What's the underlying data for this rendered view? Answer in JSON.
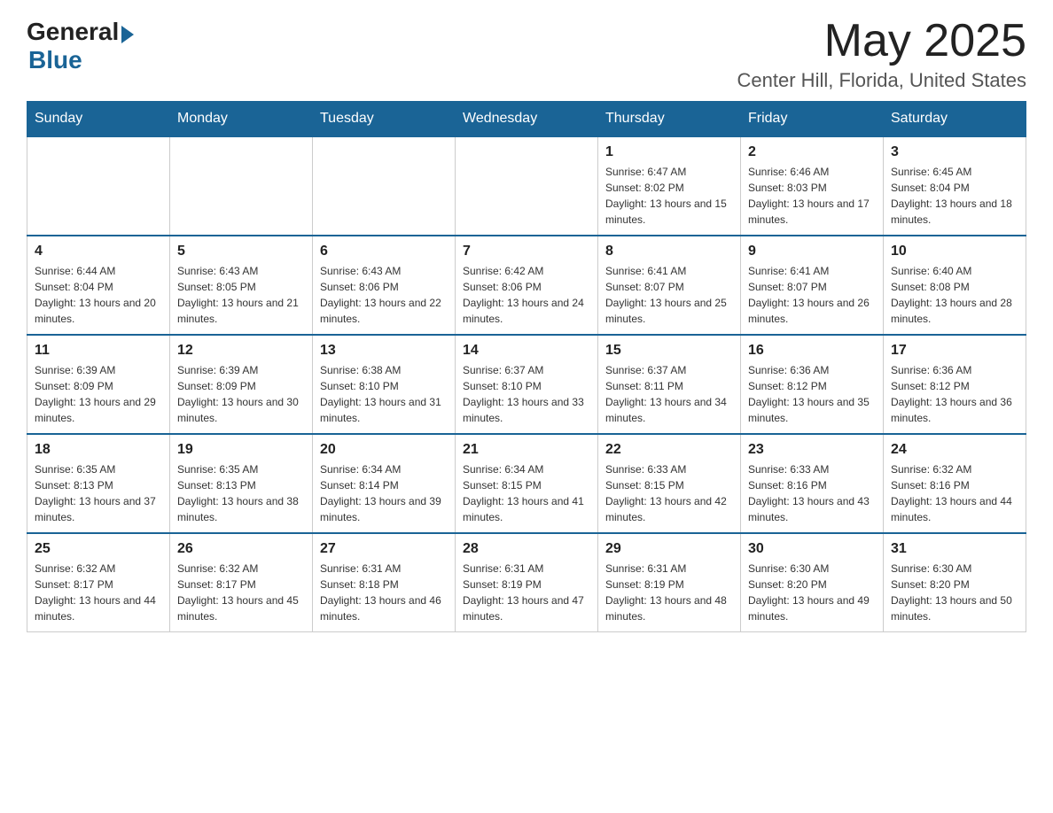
{
  "header": {
    "logo_general": "General",
    "logo_blue": "Blue",
    "month": "May 2025",
    "location": "Center Hill, Florida, United States"
  },
  "days_of_week": [
    "Sunday",
    "Monday",
    "Tuesday",
    "Wednesday",
    "Thursday",
    "Friday",
    "Saturday"
  ],
  "weeks": [
    [
      {
        "day": "",
        "info": ""
      },
      {
        "day": "",
        "info": ""
      },
      {
        "day": "",
        "info": ""
      },
      {
        "day": "",
        "info": ""
      },
      {
        "day": "1",
        "info": "Sunrise: 6:47 AM\nSunset: 8:02 PM\nDaylight: 13 hours and 15 minutes."
      },
      {
        "day": "2",
        "info": "Sunrise: 6:46 AM\nSunset: 8:03 PM\nDaylight: 13 hours and 17 minutes."
      },
      {
        "day": "3",
        "info": "Sunrise: 6:45 AM\nSunset: 8:04 PM\nDaylight: 13 hours and 18 minutes."
      }
    ],
    [
      {
        "day": "4",
        "info": "Sunrise: 6:44 AM\nSunset: 8:04 PM\nDaylight: 13 hours and 20 minutes."
      },
      {
        "day": "5",
        "info": "Sunrise: 6:43 AM\nSunset: 8:05 PM\nDaylight: 13 hours and 21 minutes."
      },
      {
        "day": "6",
        "info": "Sunrise: 6:43 AM\nSunset: 8:06 PM\nDaylight: 13 hours and 22 minutes."
      },
      {
        "day": "7",
        "info": "Sunrise: 6:42 AM\nSunset: 8:06 PM\nDaylight: 13 hours and 24 minutes."
      },
      {
        "day": "8",
        "info": "Sunrise: 6:41 AM\nSunset: 8:07 PM\nDaylight: 13 hours and 25 minutes."
      },
      {
        "day": "9",
        "info": "Sunrise: 6:41 AM\nSunset: 8:07 PM\nDaylight: 13 hours and 26 minutes."
      },
      {
        "day": "10",
        "info": "Sunrise: 6:40 AM\nSunset: 8:08 PM\nDaylight: 13 hours and 28 minutes."
      }
    ],
    [
      {
        "day": "11",
        "info": "Sunrise: 6:39 AM\nSunset: 8:09 PM\nDaylight: 13 hours and 29 minutes."
      },
      {
        "day": "12",
        "info": "Sunrise: 6:39 AM\nSunset: 8:09 PM\nDaylight: 13 hours and 30 minutes."
      },
      {
        "day": "13",
        "info": "Sunrise: 6:38 AM\nSunset: 8:10 PM\nDaylight: 13 hours and 31 minutes."
      },
      {
        "day": "14",
        "info": "Sunrise: 6:37 AM\nSunset: 8:10 PM\nDaylight: 13 hours and 33 minutes."
      },
      {
        "day": "15",
        "info": "Sunrise: 6:37 AM\nSunset: 8:11 PM\nDaylight: 13 hours and 34 minutes."
      },
      {
        "day": "16",
        "info": "Sunrise: 6:36 AM\nSunset: 8:12 PM\nDaylight: 13 hours and 35 minutes."
      },
      {
        "day": "17",
        "info": "Sunrise: 6:36 AM\nSunset: 8:12 PM\nDaylight: 13 hours and 36 minutes."
      }
    ],
    [
      {
        "day": "18",
        "info": "Sunrise: 6:35 AM\nSunset: 8:13 PM\nDaylight: 13 hours and 37 minutes."
      },
      {
        "day": "19",
        "info": "Sunrise: 6:35 AM\nSunset: 8:13 PM\nDaylight: 13 hours and 38 minutes."
      },
      {
        "day": "20",
        "info": "Sunrise: 6:34 AM\nSunset: 8:14 PM\nDaylight: 13 hours and 39 minutes."
      },
      {
        "day": "21",
        "info": "Sunrise: 6:34 AM\nSunset: 8:15 PM\nDaylight: 13 hours and 41 minutes."
      },
      {
        "day": "22",
        "info": "Sunrise: 6:33 AM\nSunset: 8:15 PM\nDaylight: 13 hours and 42 minutes."
      },
      {
        "day": "23",
        "info": "Sunrise: 6:33 AM\nSunset: 8:16 PM\nDaylight: 13 hours and 43 minutes."
      },
      {
        "day": "24",
        "info": "Sunrise: 6:32 AM\nSunset: 8:16 PM\nDaylight: 13 hours and 44 minutes."
      }
    ],
    [
      {
        "day": "25",
        "info": "Sunrise: 6:32 AM\nSunset: 8:17 PM\nDaylight: 13 hours and 44 minutes."
      },
      {
        "day": "26",
        "info": "Sunrise: 6:32 AM\nSunset: 8:17 PM\nDaylight: 13 hours and 45 minutes."
      },
      {
        "day": "27",
        "info": "Sunrise: 6:31 AM\nSunset: 8:18 PM\nDaylight: 13 hours and 46 minutes."
      },
      {
        "day": "28",
        "info": "Sunrise: 6:31 AM\nSunset: 8:19 PM\nDaylight: 13 hours and 47 minutes."
      },
      {
        "day": "29",
        "info": "Sunrise: 6:31 AM\nSunset: 8:19 PM\nDaylight: 13 hours and 48 minutes."
      },
      {
        "day": "30",
        "info": "Sunrise: 6:30 AM\nSunset: 8:20 PM\nDaylight: 13 hours and 49 minutes."
      },
      {
        "day": "31",
        "info": "Sunrise: 6:30 AM\nSunset: 8:20 PM\nDaylight: 13 hours and 50 minutes."
      }
    ]
  ],
  "colors": {
    "header_bg": "#1a6496",
    "header_text": "#ffffff",
    "border": "#cccccc",
    "accent": "#1a6496"
  }
}
